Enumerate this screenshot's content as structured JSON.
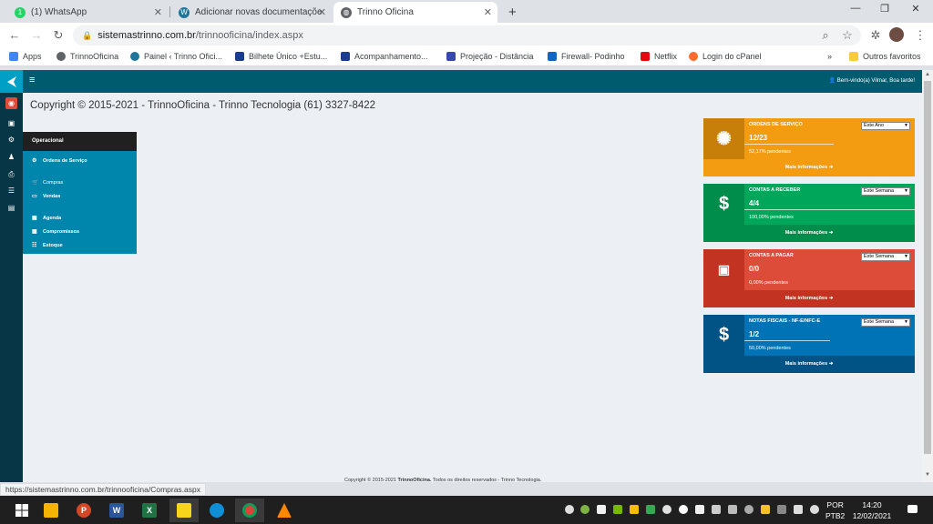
{
  "browser": {
    "tabs": [
      {
        "label": "(1) WhatsApp",
        "icon": "whatsapp-icon",
        "badge": "1"
      },
      {
        "label": "Adicionar novas documentações",
        "icon": "wordpress-icon"
      },
      {
        "label": "Trinno Oficina",
        "icon": "globe-icon"
      }
    ],
    "new_tab": "+",
    "url_host": "sistemastrinno.com.br",
    "url_path": "/trinnooficina/index.aspx",
    "bookmarks": [
      {
        "label": "Apps",
        "icon": "apps-grid-icon",
        "color": "#4285f4"
      },
      {
        "label": "TrinnoOficina",
        "icon": "globe-icon",
        "color": "#5f6368"
      },
      {
        "label": "Painel ‹ Trinno Ofici...",
        "icon": "wordpress-icon",
        "color": "#21759b"
      },
      {
        "label": "Bilhete Único +Estu...",
        "icon": "ticket-icon",
        "color": "#1a3d8f"
      },
      {
        "label": "Acompanhamento...",
        "icon": "ticket-icon",
        "color": "#1a3d8f"
      },
      {
        "label": "Projeção - Distância",
        "icon": "feather-icon",
        "color": "#3949ab"
      },
      {
        "label": "Firewall- Podinho",
        "icon": "pf-icon",
        "color": "#1565c0"
      },
      {
        "label": "Netflix",
        "icon": "netflix-icon",
        "color": "#e50914"
      },
      {
        "label": "Login do cPanel",
        "icon": "cpanel-icon",
        "color": "#ff6c2c"
      }
    ],
    "bookmarks_more": "»",
    "other_favorites": "Outros favoritos"
  },
  "app": {
    "welcome": "Bem-vindo(a) Vilmar, Boa tarde!",
    "copyright_title": "Copyright © 2015-2021 - TrinnoOficina - Trinno Tecnologia (61) 3327-8422",
    "menu": {
      "header": "Operacional",
      "items": [
        {
          "label": "Ordens de Serviço",
          "icon": "gear-icon"
        },
        {
          "label": "Compras",
          "icon": "cart-icon"
        },
        {
          "label": "Vendas",
          "icon": "money-icon"
        },
        {
          "label": "Agenda",
          "icon": "calendar-icon"
        },
        {
          "label": "Compromissos",
          "icon": "calendar-check-icon"
        },
        {
          "label": "Estoque",
          "icon": "list-icon"
        }
      ]
    },
    "widgets": [
      {
        "title": "ORDENS DE SERVIÇO",
        "value": "12/23",
        "percent": "52,17% pendentes",
        "period": "Este Ano",
        "more": "Mais informações",
        "icon": "gears-icon",
        "color": "#f39c12",
        "dark": "#c87f0a",
        "fill": 0.5217
      },
      {
        "title": "CONTAS A RECEBER",
        "value": "4/4",
        "percent": "100,00% pendentes",
        "period": "Este Semana",
        "more": "Mais informações",
        "icon": "dollar-icon",
        "color": "#00a65a",
        "dark": "#008d4c",
        "fill": 1.0
      },
      {
        "title": "CONTAS A PAGAR",
        "value": "0/0",
        "percent": "0,00% pendentes",
        "period": "Este Semana",
        "more": "Mais informações",
        "icon": "banknote-icon",
        "color": "#dd4b39",
        "dark": "#c23321",
        "fill": 0.0
      },
      {
        "title": "NOTAS FISCAIS - NF-E/NFC-E",
        "value": "1/2",
        "percent": "50,00% pendentes",
        "period": "Este Semana",
        "more": "Mais informações",
        "icon": "dollar-icon",
        "color": "#0073b7",
        "dark": "#005384",
        "fill": 0.5
      }
    ],
    "footer_prefix": "Copyright © 2015-2021 ",
    "footer_brand": "TrinnoOficina.",
    "footer_suffix": " Todos os direitos reservados - Trinno Tecnologia."
  },
  "status_url": "https://sistemastrinno.com.br/trinnooficina/Compras.aspx",
  "taskbar": {
    "lang_top": "POR",
    "lang_bottom": "PTB2",
    "time": "14:20",
    "date": "12/02/2021"
  }
}
